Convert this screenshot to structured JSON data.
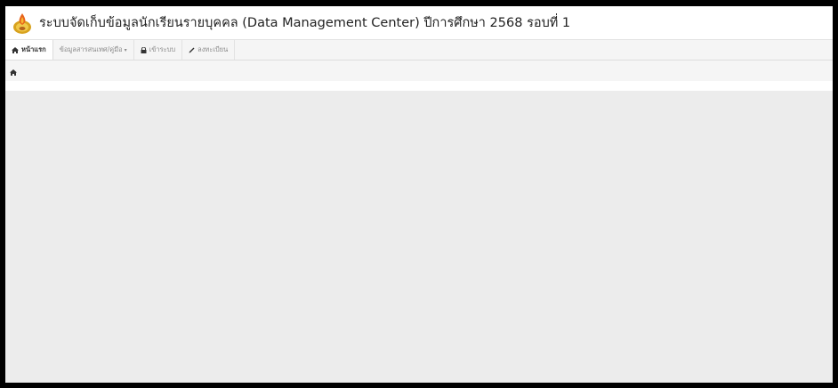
{
  "header": {
    "title": "ระบบจัดเก็บข้อมูลนักเรียนรายบุคคล (Data Management Center) ปีการศึกษา 2568 รอบที่ 1",
    "logo_icon": "school-emblem-icon"
  },
  "navbar": {
    "items": [
      {
        "label": "หน้าแรก",
        "icon": "home-icon",
        "active": true
      },
      {
        "label": "ข้อมูลสารสนเทศ/คู่มือ",
        "icon": "",
        "dropdown": true
      },
      {
        "label": "เข้าระบบ",
        "icon": "lock-icon"
      },
      {
        "label": "ลงทะเบียน",
        "icon": "pencil-icon"
      }
    ]
  },
  "breadcrumb": {
    "icon": "home-icon"
  },
  "colors": {
    "page_background": "#ececec",
    "navbar_background": "#f5f5f5",
    "active_tab": "#ffffff",
    "outer_frame": "#000000"
  }
}
